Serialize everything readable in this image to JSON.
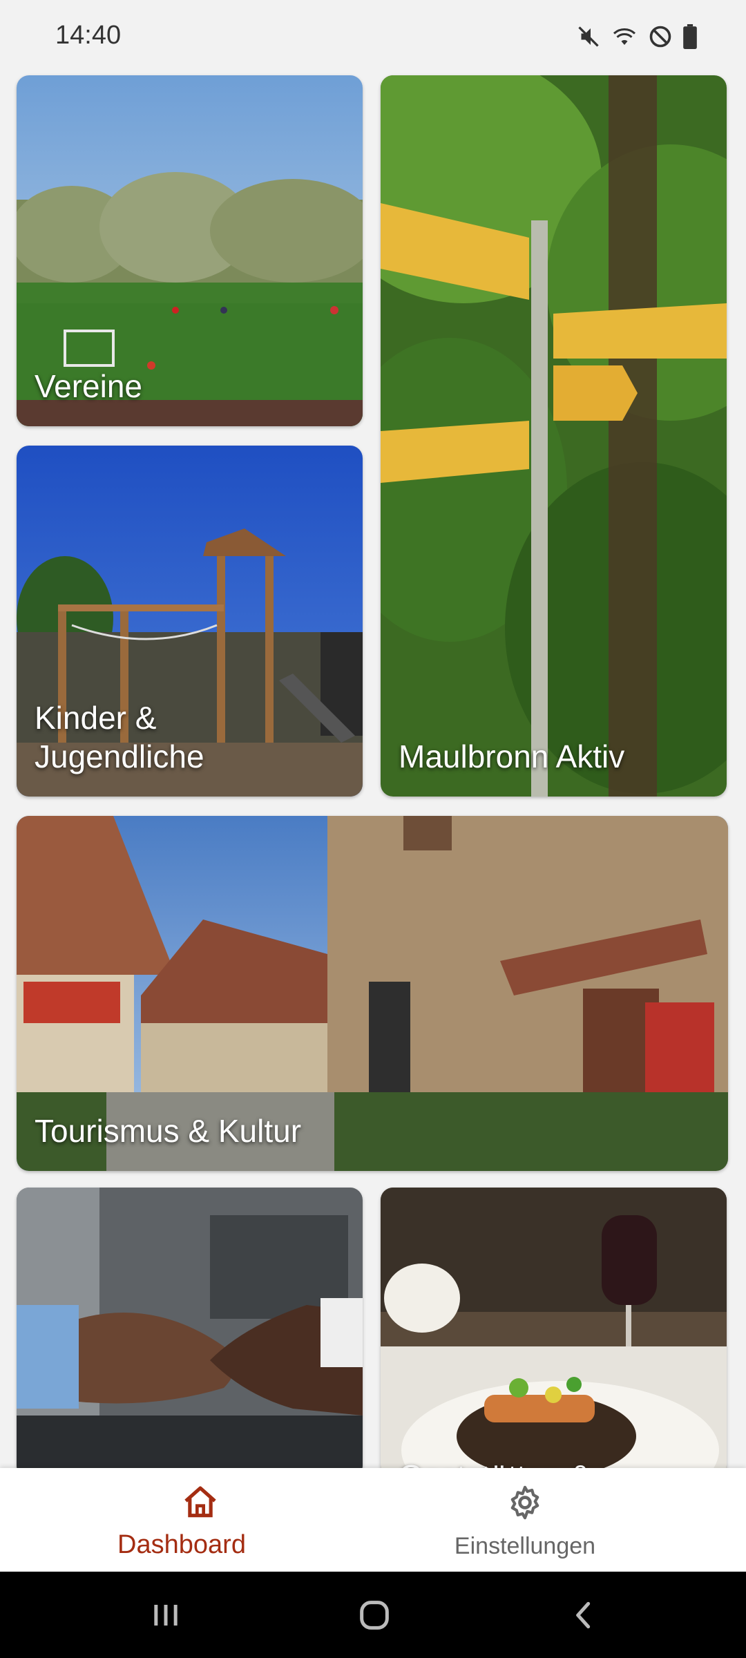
{
  "status_bar": {
    "time": "14:40",
    "icons": [
      "mute-icon",
      "wifi-icon",
      "do-not-disturb-icon",
      "battery-icon"
    ]
  },
  "tiles": [
    {
      "label": "Vereine"
    },
    {
      "label": "Maulbronn Aktiv"
    },
    {
      "label": "Kinder & Jugendliche"
    },
    {
      "label": "Tourismus & Kultur"
    },
    {
      "label": ""
    },
    {
      "label": "Gaststätten &"
    }
  ],
  "bottom_nav": {
    "items": [
      {
        "label": "Dashboard",
        "icon": "home-icon",
        "active": true
      },
      {
        "label": "Einstellungen",
        "icon": "gear-icon",
        "active": false
      }
    ],
    "accent": "#a42d12"
  },
  "system_nav": {
    "buttons": [
      "recent-apps-icon",
      "home-button-icon",
      "back-icon"
    ]
  }
}
